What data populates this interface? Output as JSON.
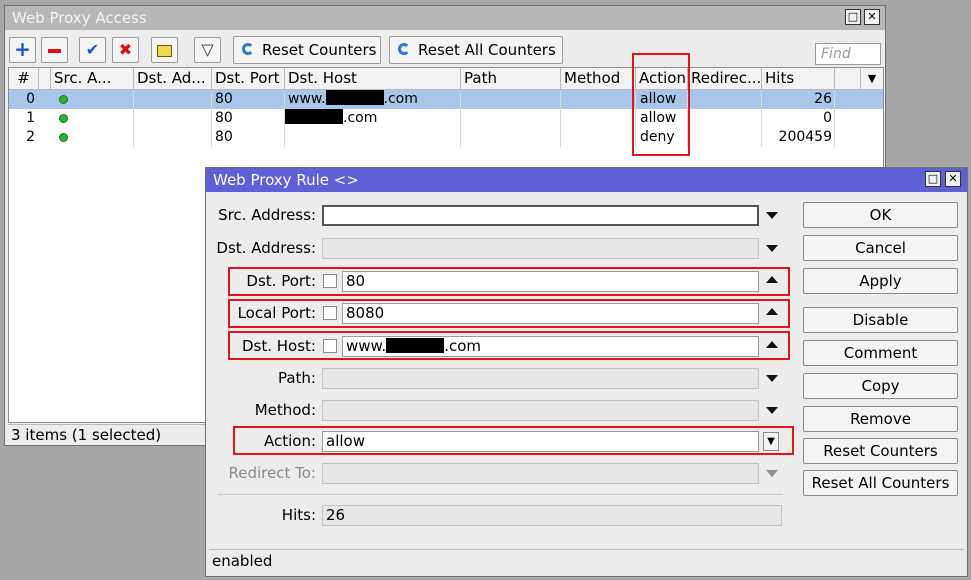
{
  "access_window": {
    "title": "Web Proxy Access",
    "toolbar": {
      "reset_counters": "Reset Counters",
      "reset_all_counters": "Reset All Counters",
      "find_placeholder": "Find"
    },
    "columns": [
      "#",
      "Src. A...",
      "Dst. Ad...",
      "Dst. Port",
      "Dst. Host",
      "Path",
      "Method",
      "Action",
      "Redirec...",
      "Hits"
    ],
    "rows": [
      {
        "num": "0",
        "dst_port": "80",
        "host_prefix": "www.",
        "host_suffix": ".com",
        "action": "allow",
        "hits": "26"
      },
      {
        "num": "1",
        "dst_port": "80",
        "host_prefix": "",
        "host_suffix": ".com",
        "action": "allow",
        "hits": "0"
      },
      {
        "num": "2",
        "dst_port": "80",
        "host_prefix": "",
        "host_suffix": "",
        "action": "deny",
        "hits": "200459"
      }
    ],
    "status": "3 items (1 selected)"
  },
  "rule_window": {
    "title": "Web Proxy Rule <>",
    "labels": {
      "src_address": "Src. Address:",
      "dst_address": "Dst. Address:",
      "dst_port": "Dst. Port:",
      "local_port": "Local Port:",
      "dst_host": "Dst. Host:",
      "path": "Path:",
      "method": "Method:",
      "action": "Action:",
      "redirect_to": "Redirect To:",
      "hits": "Hits:"
    },
    "values": {
      "dst_port": "80",
      "local_port": "8080",
      "dst_host_prefix": "www.",
      "dst_host_suffix": ".com",
      "action": "allow",
      "hits": "26"
    },
    "buttons": {
      "ok": "OK",
      "cancel": "Cancel",
      "apply": "Apply",
      "disable": "Disable",
      "comment": "Comment",
      "copy": "Copy",
      "remove": "Remove",
      "reset_counters": "Reset Counters",
      "reset_all_counters": "Reset All Counters"
    },
    "status": "enabled"
  },
  "colors": {
    "highlight_box": "#e0141e",
    "selected_row": "#a9c6ea",
    "active_title": "#5f5fd6"
  }
}
